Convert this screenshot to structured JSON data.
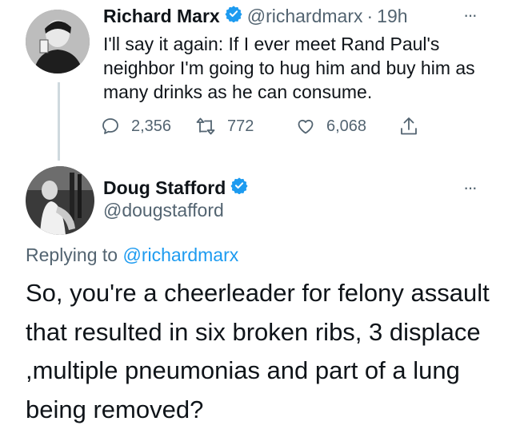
{
  "tweet": {
    "author_name": "Richard Marx",
    "handle": "@richardmarx",
    "separator": "·",
    "time": "19h",
    "text": "I'll say it again: If I ever meet Rand Paul's neighbor I'm going to hug him and buy him as many drinks as he can consume.",
    "replies": "2,356",
    "retweets": "772",
    "likes": "6,068"
  },
  "reply": {
    "author_name": "Doug Stafford",
    "handle": "@dougstafford",
    "replying_prefix": "Replying to",
    "replying_to": "@richardmarx",
    "text": "So, you're a cheerleader for felony assault that resulted in six broken ribs, 3 displace ,multiple pneumonias and part of a lung being removed?"
  },
  "icons": {
    "verified": "verified-badge-icon",
    "more": "more-options-icon",
    "reply": "reply-icon",
    "retweet": "retweet-icon",
    "like": "heart-icon",
    "share": "share-icon"
  },
  "colors": {
    "accent": "#1d9bf0",
    "secondary_text": "#536471",
    "primary_text": "#0f1419",
    "thread_line": "#cfd9de"
  },
  "more_glyph": "···"
}
